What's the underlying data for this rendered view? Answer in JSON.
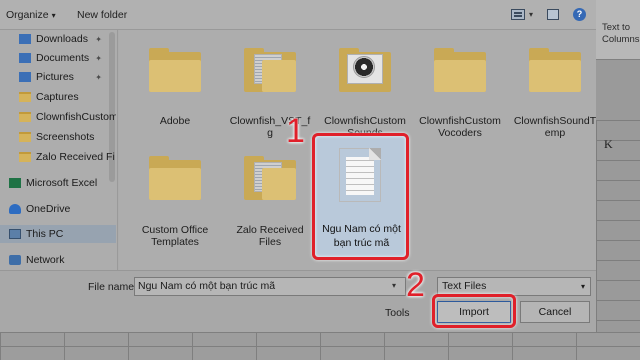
{
  "toolbar": {
    "organize_label": "Organize",
    "organize_caret": "▾",
    "new_folder_label": "New folder",
    "help_glyph": "?"
  },
  "sidebar": {
    "items": [
      {
        "label": "Downloads",
        "icon": "download-icon",
        "pinned": true
      },
      {
        "label": "Documents",
        "icon": "documents-icon",
        "pinned": true
      },
      {
        "label": "Pictures",
        "icon": "pictures-icon",
        "pinned": true
      },
      {
        "label": "Captures",
        "icon": "folder-icon",
        "pinned": false
      },
      {
        "label": "ClownfishCustom",
        "icon": "folder-icon",
        "pinned": false
      },
      {
        "label": "Screenshots",
        "icon": "folder-icon",
        "pinned": false
      },
      {
        "label": "Zalo Received Fi",
        "icon": "folder-icon",
        "pinned": false
      },
      {
        "label": "Microsoft Excel",
        "icon": "excel-icon",
        "pinned": false
      },
      {
        "label": "OneDrive",
        "icon": "cloud-icon",
        "pinned": false
      },
      {
        "label": "This PC",
        "icon": "computer-icon",
        "pinned": false,
        "selected": true
      },
      {
        "label": "Network",
        "icon": "network-icon",
        "pinned": false
      }
    ],
    "pin_glyph": "📌"
  },
  "content": {
    "tiles": [
      {
        "label": "Adobe",
        "icon": "folder-icon"
      },
      {
        "label": "Clownfish_VST_f\ng",
        "icon": "folder-with-document-icon"
      },
      {
        "label": "ClownfishCustom\nSounds",
        "icon": "folder-with-disc-icon"
      },
      {
        "label": "ClownfishCustom\nVocoders",
        "icon": "folder-icon"
      },
      {
        "label": "ClownfishSoundT\nemp",
        "icon": "folder-icon"
      },
      {
        "label": "Custom Office\nTemplates",
        "icon": "folder-icon"
      },
      {
        "label": "Zalo Received\nFiles",
        "icon": "folder-with-document-icon"
      }
    ],
    "selected_file": {
      "label": "Ngu Nam có một\nbạn trúc mã",
      "icon": "text-document-icon"
    }
  },
  "footer": {
    "file_name_label": "File name:",
    "file_name_value": "Ngu Nam có một bạn trúc mã",
    "file_type_value": "Text Files",
    "tools_label": "Tools",
    "import_label": "Import",
    "cancel_label": "Cancel"
  },
  "annotations": {
    "step1": "1",
    "step2": "2",
    "color": "#e0202a"
  },
  "excel": {
    "ribbon_text": "Text to\nColumns",
    "column_label": "K"
  }
}
